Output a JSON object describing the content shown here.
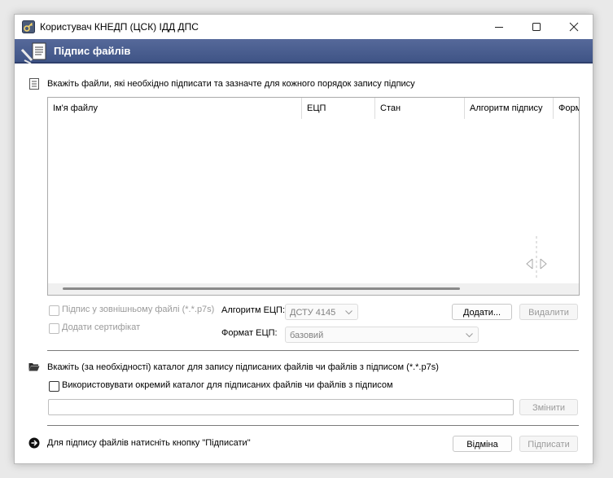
{
  "window": {
    "title": "Користувач КНЕДП (ЦСК) ІДД ДПС",
    "minimize_icon": "minimize-icon",
    "maximize_icon": "maximize-icon",
    "close_icon": "close-icon"
  },
  "header": {
    "title": "Підпис файлів"
  },
  "files_section": {
    "instruction": "Вкажіть файли, які необхідно підписати та зазначте для кожного порядок запису підпису",
    "columns": [
      "Ім'я файлу",
      "ЕЦП",
      "Стан",
      "Алгоритм підпису",
      "Формат ЕЦП"
    ],
    "rows": []
  },
  "options": {
    "external_file_label": "Підпис у зовнішньому файлі (*.*.p7s)",
    "add_certificate_label": "Додати сертифікат",
    "algorithm_label": "Алгоритм ЕЦП:",
    "algorithm_value": "ДСТУ 4145",
    "format_label": "Формат ЕЦП:",
    "format_value": "базовий",
    "add_button": "Додати...",
    "remove_button": "Видалити"
  },
  "output_section": {
    "instruction": "Вкажіть (за необхідності) каталог для запису підписаних файлів чи файлів з підписом (*.*.p7s)",
    "separate_dir_label": "Використовувати окремий каталог для підписаних файлів чи файлів з підписом",
    "path_value": "",
    "change_button": "Змінити"
  },
  "footer": {
    "hint": "Для підпису файлів натисніть кнопку \"Підписати\"",
    "cancel_button": "Відміна",
    "sign_button": "Підписати"
  },
  "colors": {
    "header_band": "#4a5e90",
    "disabled_text": "#9a9a9a"
  }
}
